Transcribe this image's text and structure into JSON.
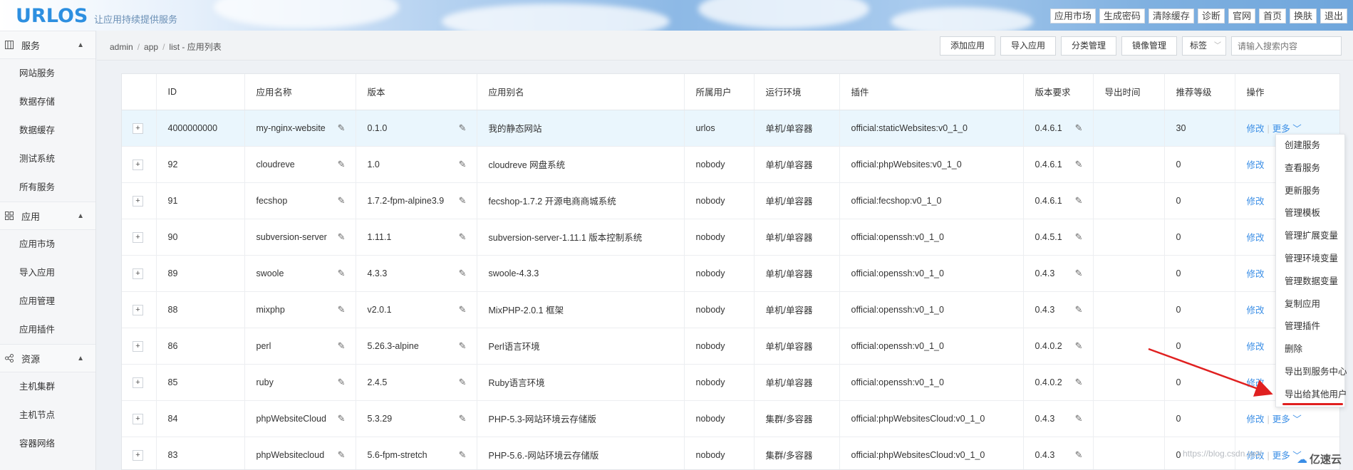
{
  "header": {
    "logo": "URLOS",
    "slogan": "让应用持续提供服务",
    "nav": [
      "应用市场",
      "生成密码",
      "清除缓存",
      "诊断",
      "官网",
      "首页",
      "换肤",
      "退出"
    ]
  },
  "sidebar": {
    "groups": [
      {
        "label": "服务",
        "icon": "grid-icon",
        "items": [
          "网站服务",
          "数据存储",
          "数据缓存",
          "测试系统",
          "所有服务"
        ]
      },
      {
        "label": "应用",
        "icon": "apps-icon",
        "items": [
          "应用市场",
          "导入应用",
          "应用管理",
          "应用插件"
        ]
      },
      {
        "label": "资源",
        "icon": "share-icon",
        "items": [
          "主机集群",
          "主机节点",
          "容器网络"
        ]
      }
    ]
  },
  "breadcrumb": [
    "admin",
    "app",
    "list - 应用列表"
  ],
  "actions": {
    "buttons": [
      "添加应用",
      "导入应用",
      "分类管理",
      "镜像管理"
    ],
    "tag_select": "标签",
    "search_placeholder": "请输入搜索内容"
  },
  "table": {
    "columns": [
      "",
      "ID",
      "应用名称",
      "版本",
      "应用别名",
      "所属用户",
      "运行环境",
      "插件",
      "版本要求",
      "导出时间",
      "推荐等级",
      "操作"
    ],
    "rows": [
      {
        "id": "4000000000",
        "name": "my-nginx-website",
        "version": "0.1.0",
        "alias": "我的静态网站",
        "user": "urlos",
        "env": "单机/单容器",
        "plugin": "official:staticWebsites:v0_1_0",
        "req": "0.4.6.1",
        "export": "",
        "level": "30"
      },
      {
        "id": "92",
        "name": "cloudreve",
        "version": "1.0",
        "alias": "cloudreve 网盘系统",
        "user": "nobody",
        "env": "单机/单容器",
        "plugin": "official:phpWebsites:v0_1_0",
        "req": "0.4.6.1",
        "export": "",
        "level": "0"
      },
      {
        "id": "91",
        "name": "fecshop",
        "version": "1.7.2-fpm-alpine3.9",
        "alias": "fecshop-1.7.2 开源电商商城系统",
        "user": "nobody",
        "env": "单机/单容器",
        "plugin": "official:fecshop:v0_1_0",
        "req": "0.4.6.1",
        "export": "",
        "level": "0"
      },
      {
        "id": "90",
        "name": "subversion-server",
        "version": "1.11.1",
        "alias": "subversion-server-1.11.1 版本控制系统",
        "user": "nobody",
        "env": "单机/单容器",
        "plugin": "official:openssh:v0_1_0",
        "req": "0.4.5.1",
        "export": "",
        "level": "0"
      },
      {
        "id": "89",
        "name": "swoole",
        "version": "4.3.3",
        "alias": "swoole-4.3.3",
        "user": "nobody",
        "env": "单机/单容器",
        "plugin": "official:openssh:v0_1_0",
        "req": "0.4.3",
        "export": "",
        "level": "0"
      },
      {
        "id": "88",
        "name": "mixphp",
        "version": "v2.0.1",
        "alias": "MixPHP-2.0.1 框架",
        "user": "nobody",
        "env": "单机/单容器",
        "plugin": "official:openssh:v0_1_0",
        "req": "0.4.3",
        "export": "",
        "level": "0"
      },
      {
        "id": "86",
        "name": "perl",
        "version": "5.26.3-alpine",
        "alias": "Perl语言环境",
        "user": "nobody",
        "env": "单机/单容器",
        "plugin": "official:openssh:v0_1_0",
        "req": "0.4.0.2",
        "export": "",
        "level": "0"
      },
      {
        "id": "85",
        "name": "ruby",
        "version": "2.4.5",
        "alias": "Ruby语言环境",
        "user": "nobody",
        "env": "单机/单容器",
        "plugin": "official:openssh:v0_1_0",
        "req": "0.4.0.2",
        "export": "",
        "level": "0"
      },
      {
        "id": "84",
        "name": "phpWebsiteCloud",
        "version": "5.3.29",
        "alias": "PHP-5.3-网站环境云存储版",
        "user": "nobody",
        "env": "集群/多容器",
        "plugin": "official:phpWebsitesCloud:v0_1_0",
        "req": "0.4.3",
        "export": "",
        "level": "0"
      },
      {
        "id": "83",
        "name": "phpWebsitecloud",
        "version": "5.6-fpm-stretch",
        "alias": "PHP-5.6.-网站环境云存储版",
        "user": "nobody",
        "env": "集群/多容器",
        "plugin": "official:phpWebsitesCloud:v0_1_0",
        "req": "0.4.3",
        "export": "",
        "level": "0"
      }
    ],
    "op_edit": "修改",
    "op_more": "更多"
  },
  "more_menu": [
    "创建服务",
    "查看服务",
    "更新服务",
    "管理模板",
    "管理扩展变量",
    "管理环境变量",
    "管理数据变量",
    "复制应用",
    "管理插件",
    "删除",
    "导出到服务中心",
    "导出给其他用户"
  ],
  "watermark": "https://blog.csdn.net/",
  "brand": "亿速云",
  "colors": {
    "accent": "#3a8ee6",
    "annotation": "#e02020",
    "highlight_row": "#eaf6fd"
  }
}
